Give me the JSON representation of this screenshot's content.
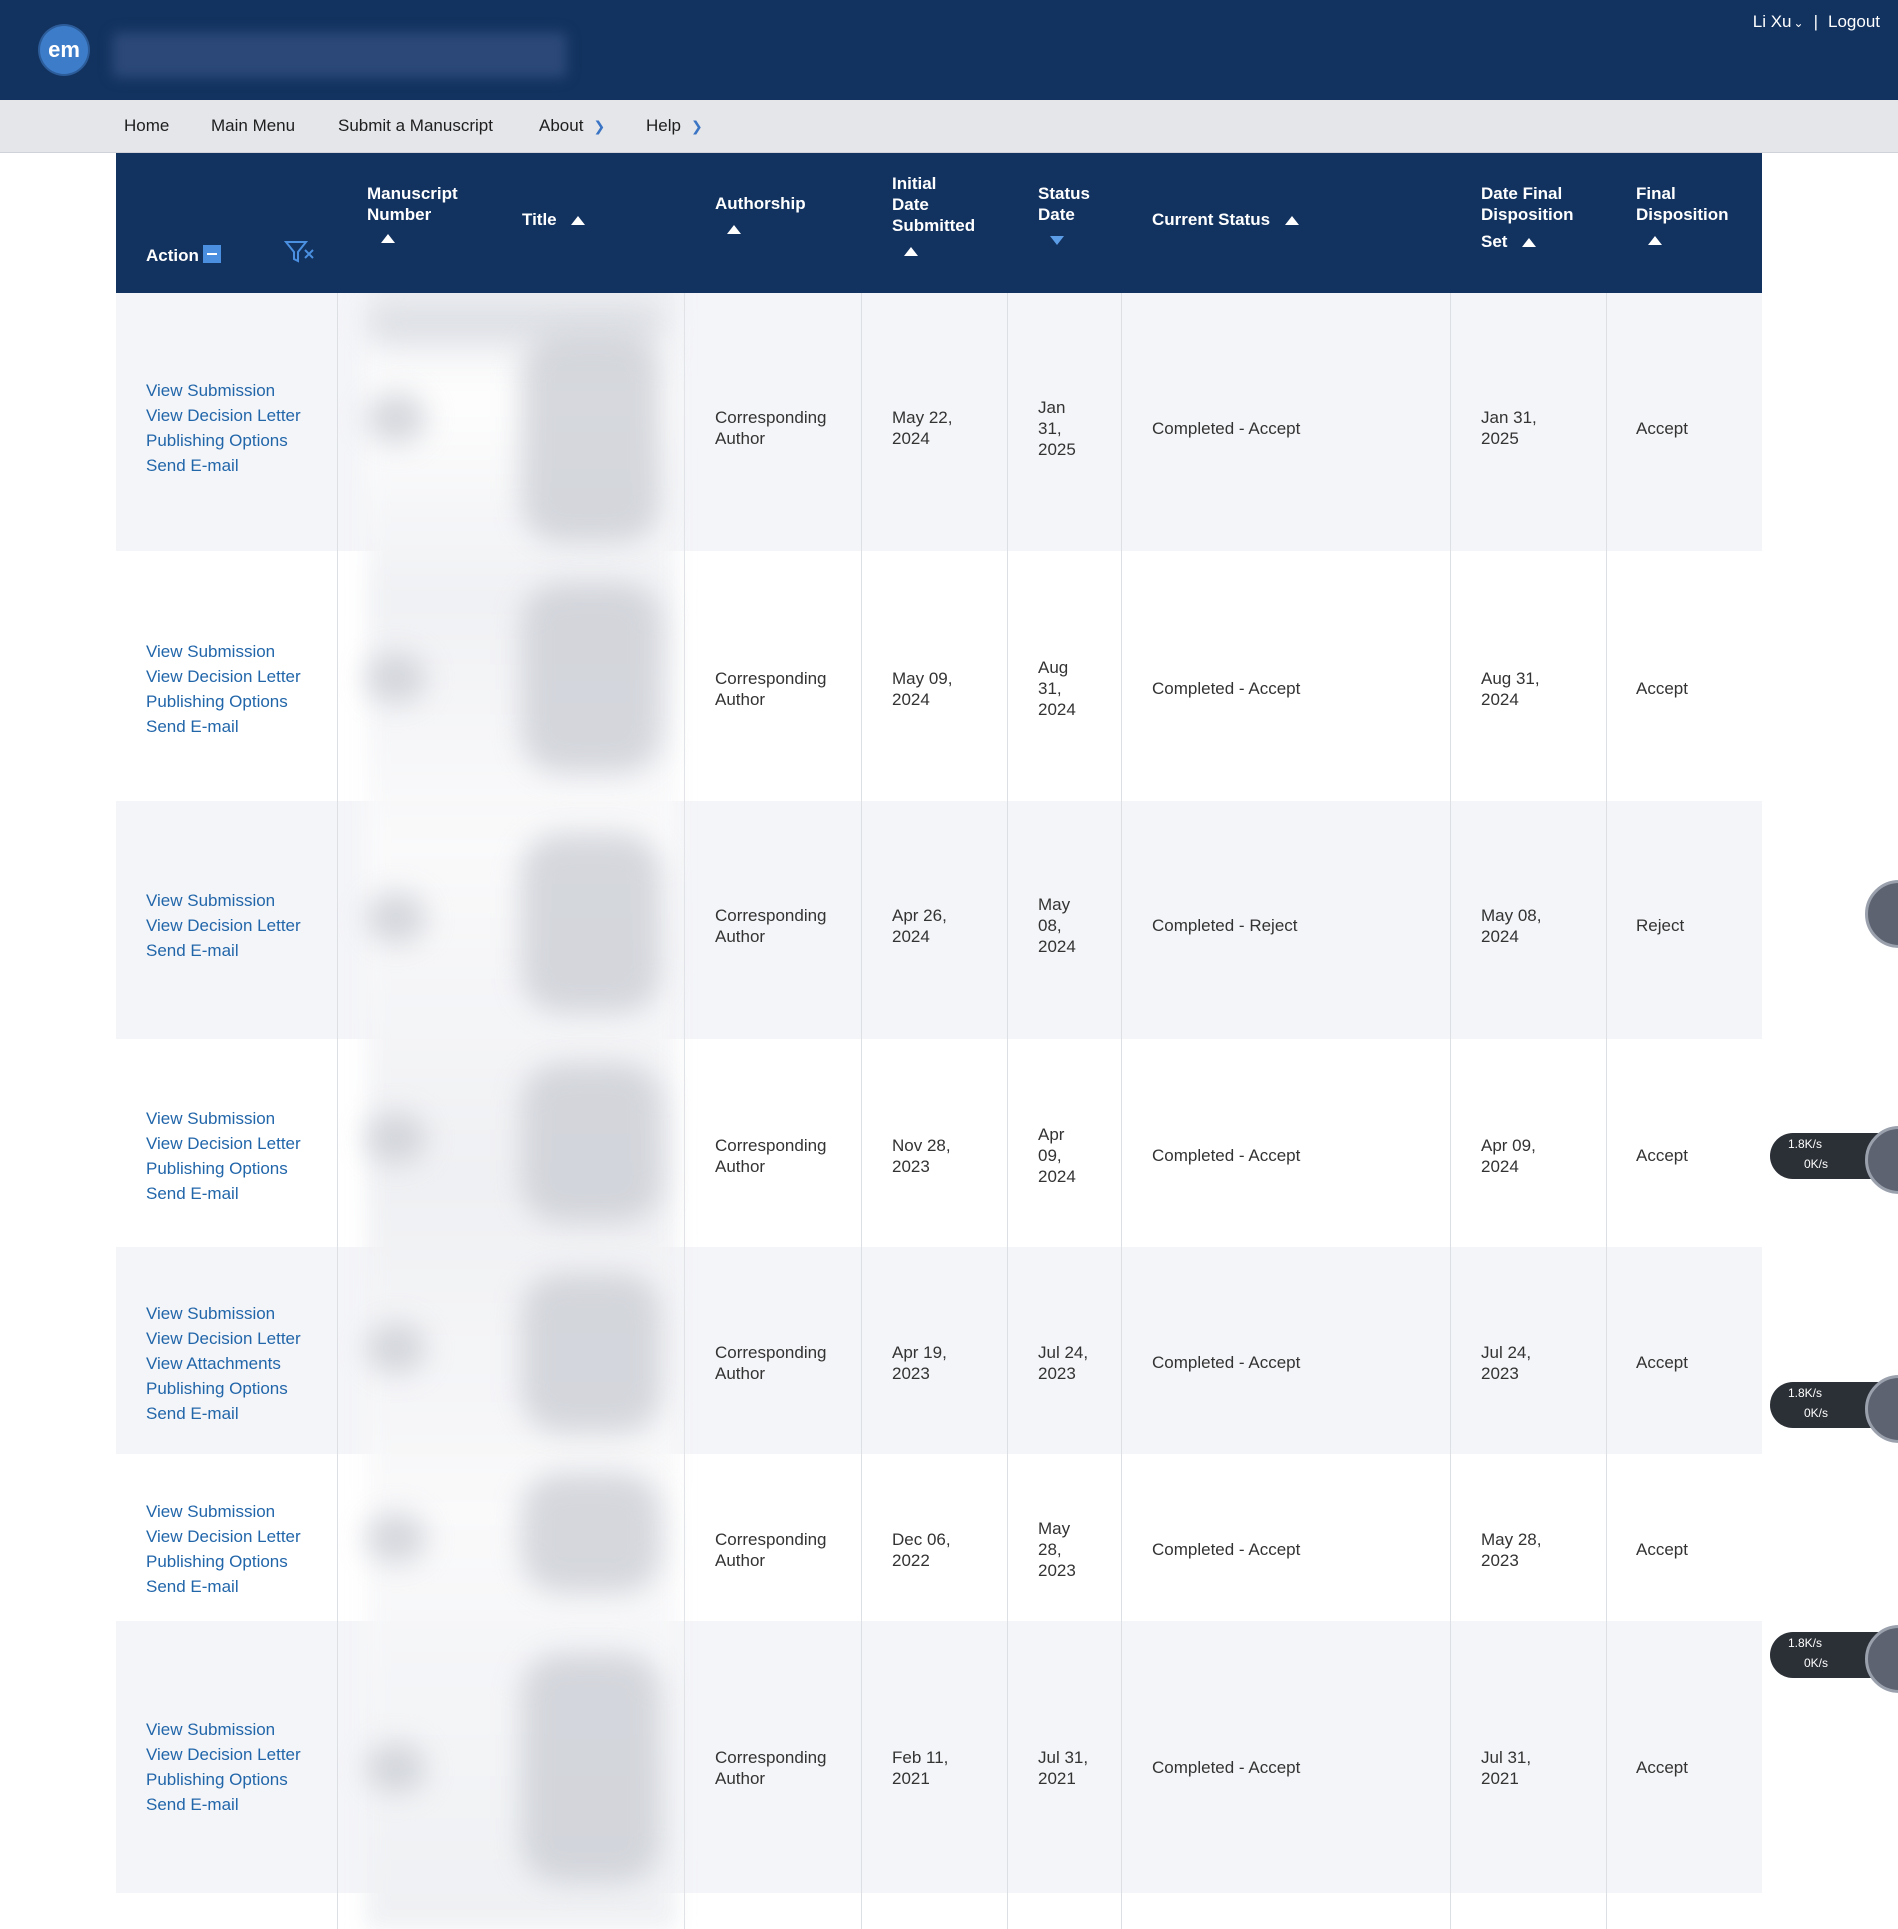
{
  "app": {
    "logo_text": "em",
    "user_name": "Li Xu",
    "logout_label": "Logout",
    "separator": "|"
  },
  "nav": {
    "items": [
      {
        "label": "Home",
        "has_menu": false
      },
      {
        "label": "Main Menu",
        "has_menu": false
      },
      {
        "label": "Submit a Manuscript",
        "has_menu": false
      },
      {
        "label": "About",
        "has_menu": true
      },
      {
        "label": "Help",
        "has_menu": true
      }
    ]
  },
  "table": {
    "headers": {
      "action": "Action",
      "manuscript_number_1": "Manuscript",
      "manuscript_number_2": "Number",
      "title": "Title",
      "authorship": "Authorship",
      "initial_1": "Initial",
      "initial_2": "Date",
      "initial_3": "Submitted",
      "status_date_1": "Status",
      "status_date_2": "Date",
      "current_status": "Current Status",
      "final_date_1": "Date Final",
      "final_date_2": "Disposition",
      "final_date_3": "Set",
      "final_disp_1": "Final",
      "final_disp_2": "Disposition"
    },
    "rows": [
      {
        "actions": [
          "View Submission",
          "View Decision Letter",
          "Publishing Options",
          "Send E-mail"
        ],
        "authorship_1": "Corresponding",
        "authorship_2": "Author",
        "initial_1": "May 22,",
        "initial_2": "2024",
        "status_date": [
          "Jan",
          "31,",
          "2025"
        ],
        "current_status": "Completed - Accept",
        "final_date_1": "Jan 31,",
        "final_date_2": "2025",
        "final_disposition": "Accept"
      },
      {
        "actions": [
          "View Submission",
          "View Decision Letter",
          "Publishing Options",
          "Send E-mail"
        ],
        "authorship_1": "Corresponding",
        "authorship_2": "Author",
        "initial_1": "May 09,",
        "initial_2": "2024",
        "status_date": [
          "Aug",
          "31,",
          "2024"
        ],
        "current_status": "Completed - Accept",
        "final_date_1": "Aug 31,",
        "final_date_2": "2024",
        "final_disposition": "Accept"
      },
      {
        "actions": [
          "View Submission",
          "View Decision Letter",
          "Send E-mail"
        ],
        "authorship_1": "Corresponding",
        "authorship_2": "Author",
        "initial_1": "Apr 26,",
        "initial_2": "2024",
        "status_date": [
          "May",
          "08,",
          "2024"
        ],
        "current_status": "Completed - Reject",
        "final_date_1": "May 08,",
        "final_date_2": "2024",
        "final_disposition": "Reject"
      },
      {
        "actions": [
          "View Submission",
          "View Decision Letter",
          "Publishing Options",
          "Send E-mail"
        ],
        "authorship_1": "Corresponding",
        "authorship_2": "Author",
        "initial_1": "Nov 28,",
        "initial_2": "2023",
        "status_date": [
          "Apr",
          "09,",
          "2024"
        ],
        "current_status": "Completed - Accept",
        "final_date_1": "Apr 09,",
        "final_date_2": "2024",
        "final_disposition": "Accept"
      },
      {
        "actions": [
          "View Submission",
          "View Decision Letter",
          "View Attachments",
          "Publishing Options",
          "Send E-mail"
        ],
        "authorship_1": "Corresponding",
        "authorship_2": "Author",
        "initial_1": "Apr 19,",
        "initial_2": "2023",
        "status_date": [
          "Jul 24,",
          "2023"
        ],
        "current_status": "Completed - Accept",
        "final_date_1": "Jul 24,",
        "final_date_2": "2023",
        "final_disposition": "Accept"
      },
      {
        "actions": [
          "View Submission",
          "View Decision Letter",
          "Publishing Options",
          "Send E-mail"
        ],
        "authorship_1": "Corresponding",
        "authorship_2": "Author",
        "initial_1": "Dec 06,",
        "initial_2": "2022",
        "status_date": [
          "May",
          "28,",
          "2023"
        ],
        "current_status": "Completed - Accept",
        "final_date_1": "May 28,",
        "final_date_2": "2023",
        "final_disposition": "Accept"
      },
      {
        "actions": [
          "View Submission",
          "View Decision Letter",
          "Publishing Options",
          "Send E-mail"
        ],
        "authorship_1": "Corresponding",
        "authorship_2": "Author",
        "initial_1": "Feb 11,",
        "initial_2": "2021",
        "status_date": [
          "Jul 31,",
          "2021"
        ],
        "current_status": "Completed - Accept",
        "final_date_1": "Jul 31,",
        "final_date_2": "2021",
        "final_disposition": "Accept"
      }
    ]
  },
  "side_widgets": [
    {
      "up": "1.8K/s",
      "down": "0K/s"
    },
    {
      "up": "1.8K/s",
      "down": "0K/s"
    },
    {
      "up": "1.8K/s",
      "down": "0K/s"
    }
  ],
  "colors": {
    "header_bg": "#12325f",
    "nav_bg": "#e4e6ea",
    "link": "#2266aa",
    "accent": "#4a8fe0"
  }
}
